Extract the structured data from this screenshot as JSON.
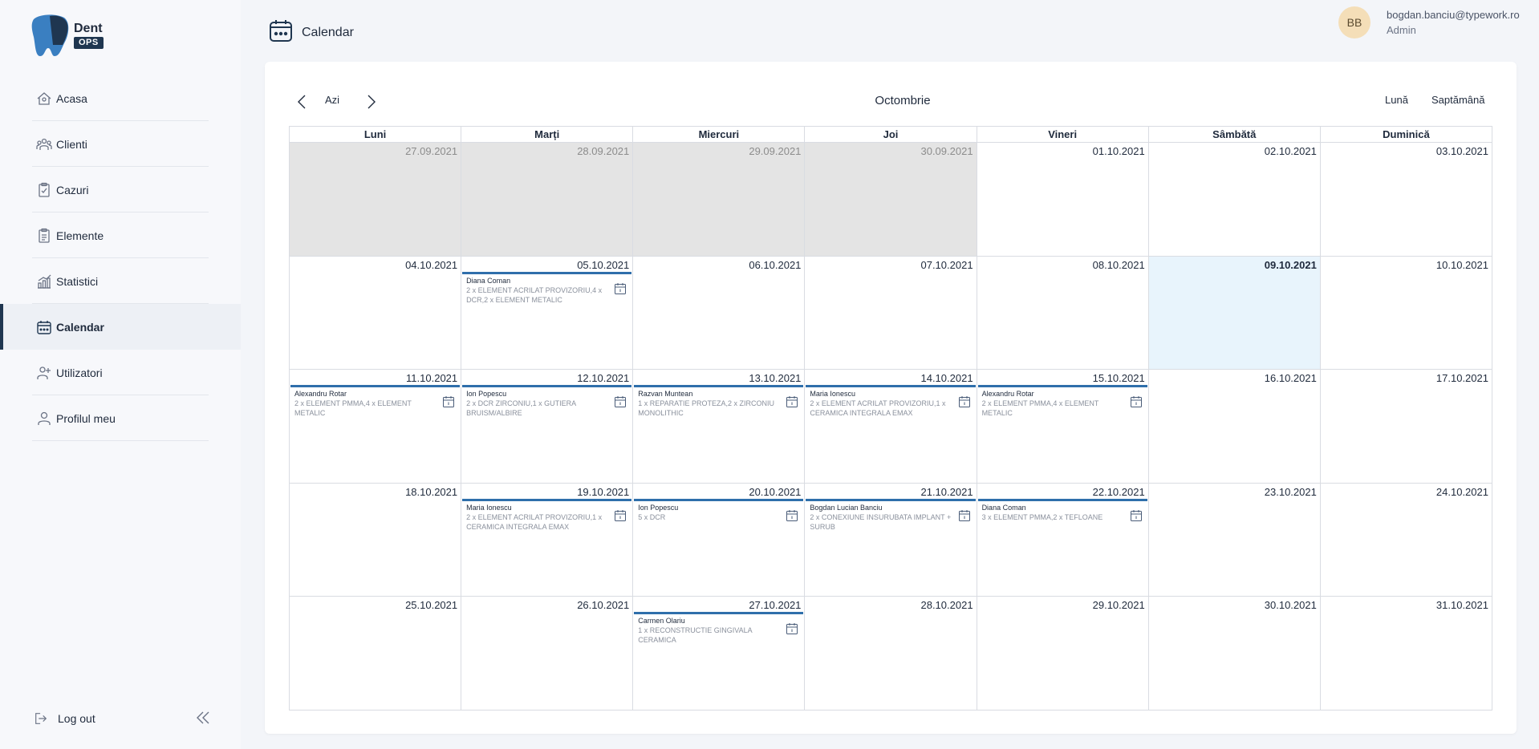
{
  "brand": {
    "name": "Dent",
    "badge": "OPS"
  },
  "nav": {
    "items": [
      {
        "key": "acasa",
        "label": "Acasa"
      },
      {
        "key": "clienti",
        "label": "Clienti"
      },
      {
        "key": "cazuri",
        "label": "Cazuri"
      },
      {
        "key": "elemente",
        "label": "Elemente"
      },
      {
        "key": "statistici",
        "label": "Statistici"
      },
      {
        "key": "calendar",
        "label": "Calendar"
      },
      {
        "key": "utilizatori",
        "label": "Utilizatori"
      },
      {
        "key": "profil",
        "label": "Profilul meu"
      }
    ],
    "active": "calendar",
    "logout_label": "Log out"
  },
  "header": {
    "title": "Calendar"
  },
  "user": {
    "initials": "BB",
    "email": "bogdan.banciu@typework.ro",
    "role": "Admin"
  },
  "toolbar": {
    "today_label": "Azi",
    "month_title": "Octombrie",
    "view_month_label": "Lună",
    "view_week_label": "Saptămână"
  },
  "calendar": {
    "weekdays": [
      "Luni",
      "Marți",
      "Miercuri",
      "Joi",
      "Vineri",
      "Sâmbătă",
      "Duminică"
    ],
    "weeks": [
      [
        {
          "date": "27.09.2021",
          "other": true
        },
        {
          "date": "28.09.2021",
          "other": true
        },
        {
          "date": "29.09.2021",
          "other": true
        },
        {
          "date": "30.09.2021",
          "other": true
        },
        {
          "date": "01.10.2021"
        },
        {
          "date": "02.10.2021"
        },
        {
          "date": "03.10.2021"
        }
      ],
      [
        {
          "date": "04.10.2021"
        },
        {
          "date": "05.10.2021",
          "event": {
            "name": "Diana Coman",
            "desc": "2 x ELEMENT ACRILAT PROVIZORIU,4 x DCR,2 x ELEMENT METALIC"
          }
        },
        {
          "date": "06.10.2021"
        },
        {
          "date": "07.10.2021"
        },
        {
          "date": "08.10.2021"
        },
        {
          "date": "09.10.2021",
          "today": true
        },
        {
          "date": "10.10.2021"
        }
      ],
      [
        {
          "date": "11.10.2021",
          "event": {
            "name": "Alexandru Rotar",
            "desc": "2 x ELEMENT PMMA,4 x ELEMENT METALIC"
          }
        },
        {
          "date": "12.10.2021",
          "event": {
            "name": "Ion Popescu",
            "desc": "2 x DCR ZIRCONIU,1 x GUTIERA BRUISM/ALBIRE"
          }
        },
        {
          "date": "13.10.2021",
          "event": {
            "name": "Razvan Muntean",
            "desc": "1 x REPARATIE PROTEZA,2 x ZIRCONIU MONOLITHIC"
          }
        },
        {
          "date": "14.10.2021",
          "event": {
            "name": "Maria Ionescu",
            "desc": "2 x ELEMENT ACRILAT PROVIZORIU,1 x CERAMICA INTEGRALA EMAX"
          }
        },
        {
          "date": "15.10.2021",
          "event": {
            "name": "Alexandru Rotar",
            "desc": "2 x ELEMENT PMMA,4 x ELEMENT METALIC"
          }
        },
        {
          "date": "16.10.2021"
        },
        {
          "date": "17.10.2021"
        }
      ],
      [
        {
          "date": "18.10.2021"
        },
        {
          "date": "19.10.2021",
          "event": {
            "name": "Maria Ionescu",
            "desc": "2 x ELEMENT ACRILAT PROVIZORIU,1 x CERAMICA INTEGRALA EMAX"
          }
        },
        {
          "date": "20.10.2021",
          "event": {
            "name": "Ion Popescu",
            "desc": "5 x DCR"
          }
        },
        {
          "date": "21.10.2021",
          "event": {
            "name": "Bogdan Lucian Banciu",
            "desc": "2 x CONEXIUNE INSURUBATA IMPLANT + SURUB"
          }
        },
        {
          "date": "22.10.2021",
          "event": {
            "name": "Diana Coman",
            "desc": "3 x ELEMENT PMMA,2 x TEFLOANE"
          }
        },
        {
          "date": "23.10.2021"
        },
        {
          "date": "24.10.2021"
        }
      ],
      [
        {
          "date": "25.10.2021"
        },
        {
          "date": "26.10.2021"
        },
        {
          "date": "27.10.2021",
          "event": {
            "name": "Carmen Olariu",
            "desc": "1 x RECONSTRUCTIE GINGIVALA CERAMICA"
          }
        },
        {
          "date": "28.10.2021"
        },
        {
          "date": "29.10.2021"
        },
        {
          "date": "30.10.2021"
        },
        {
          "date": "31.10.2021"
        }
      ]
    ]
  },
  "colors": {
    "accent": "#2f6fab",
    "navy": "#1f3650",
    "other_month": "#e4e4e4",
    "today_bg": "#e8f4fc"
  }
}
